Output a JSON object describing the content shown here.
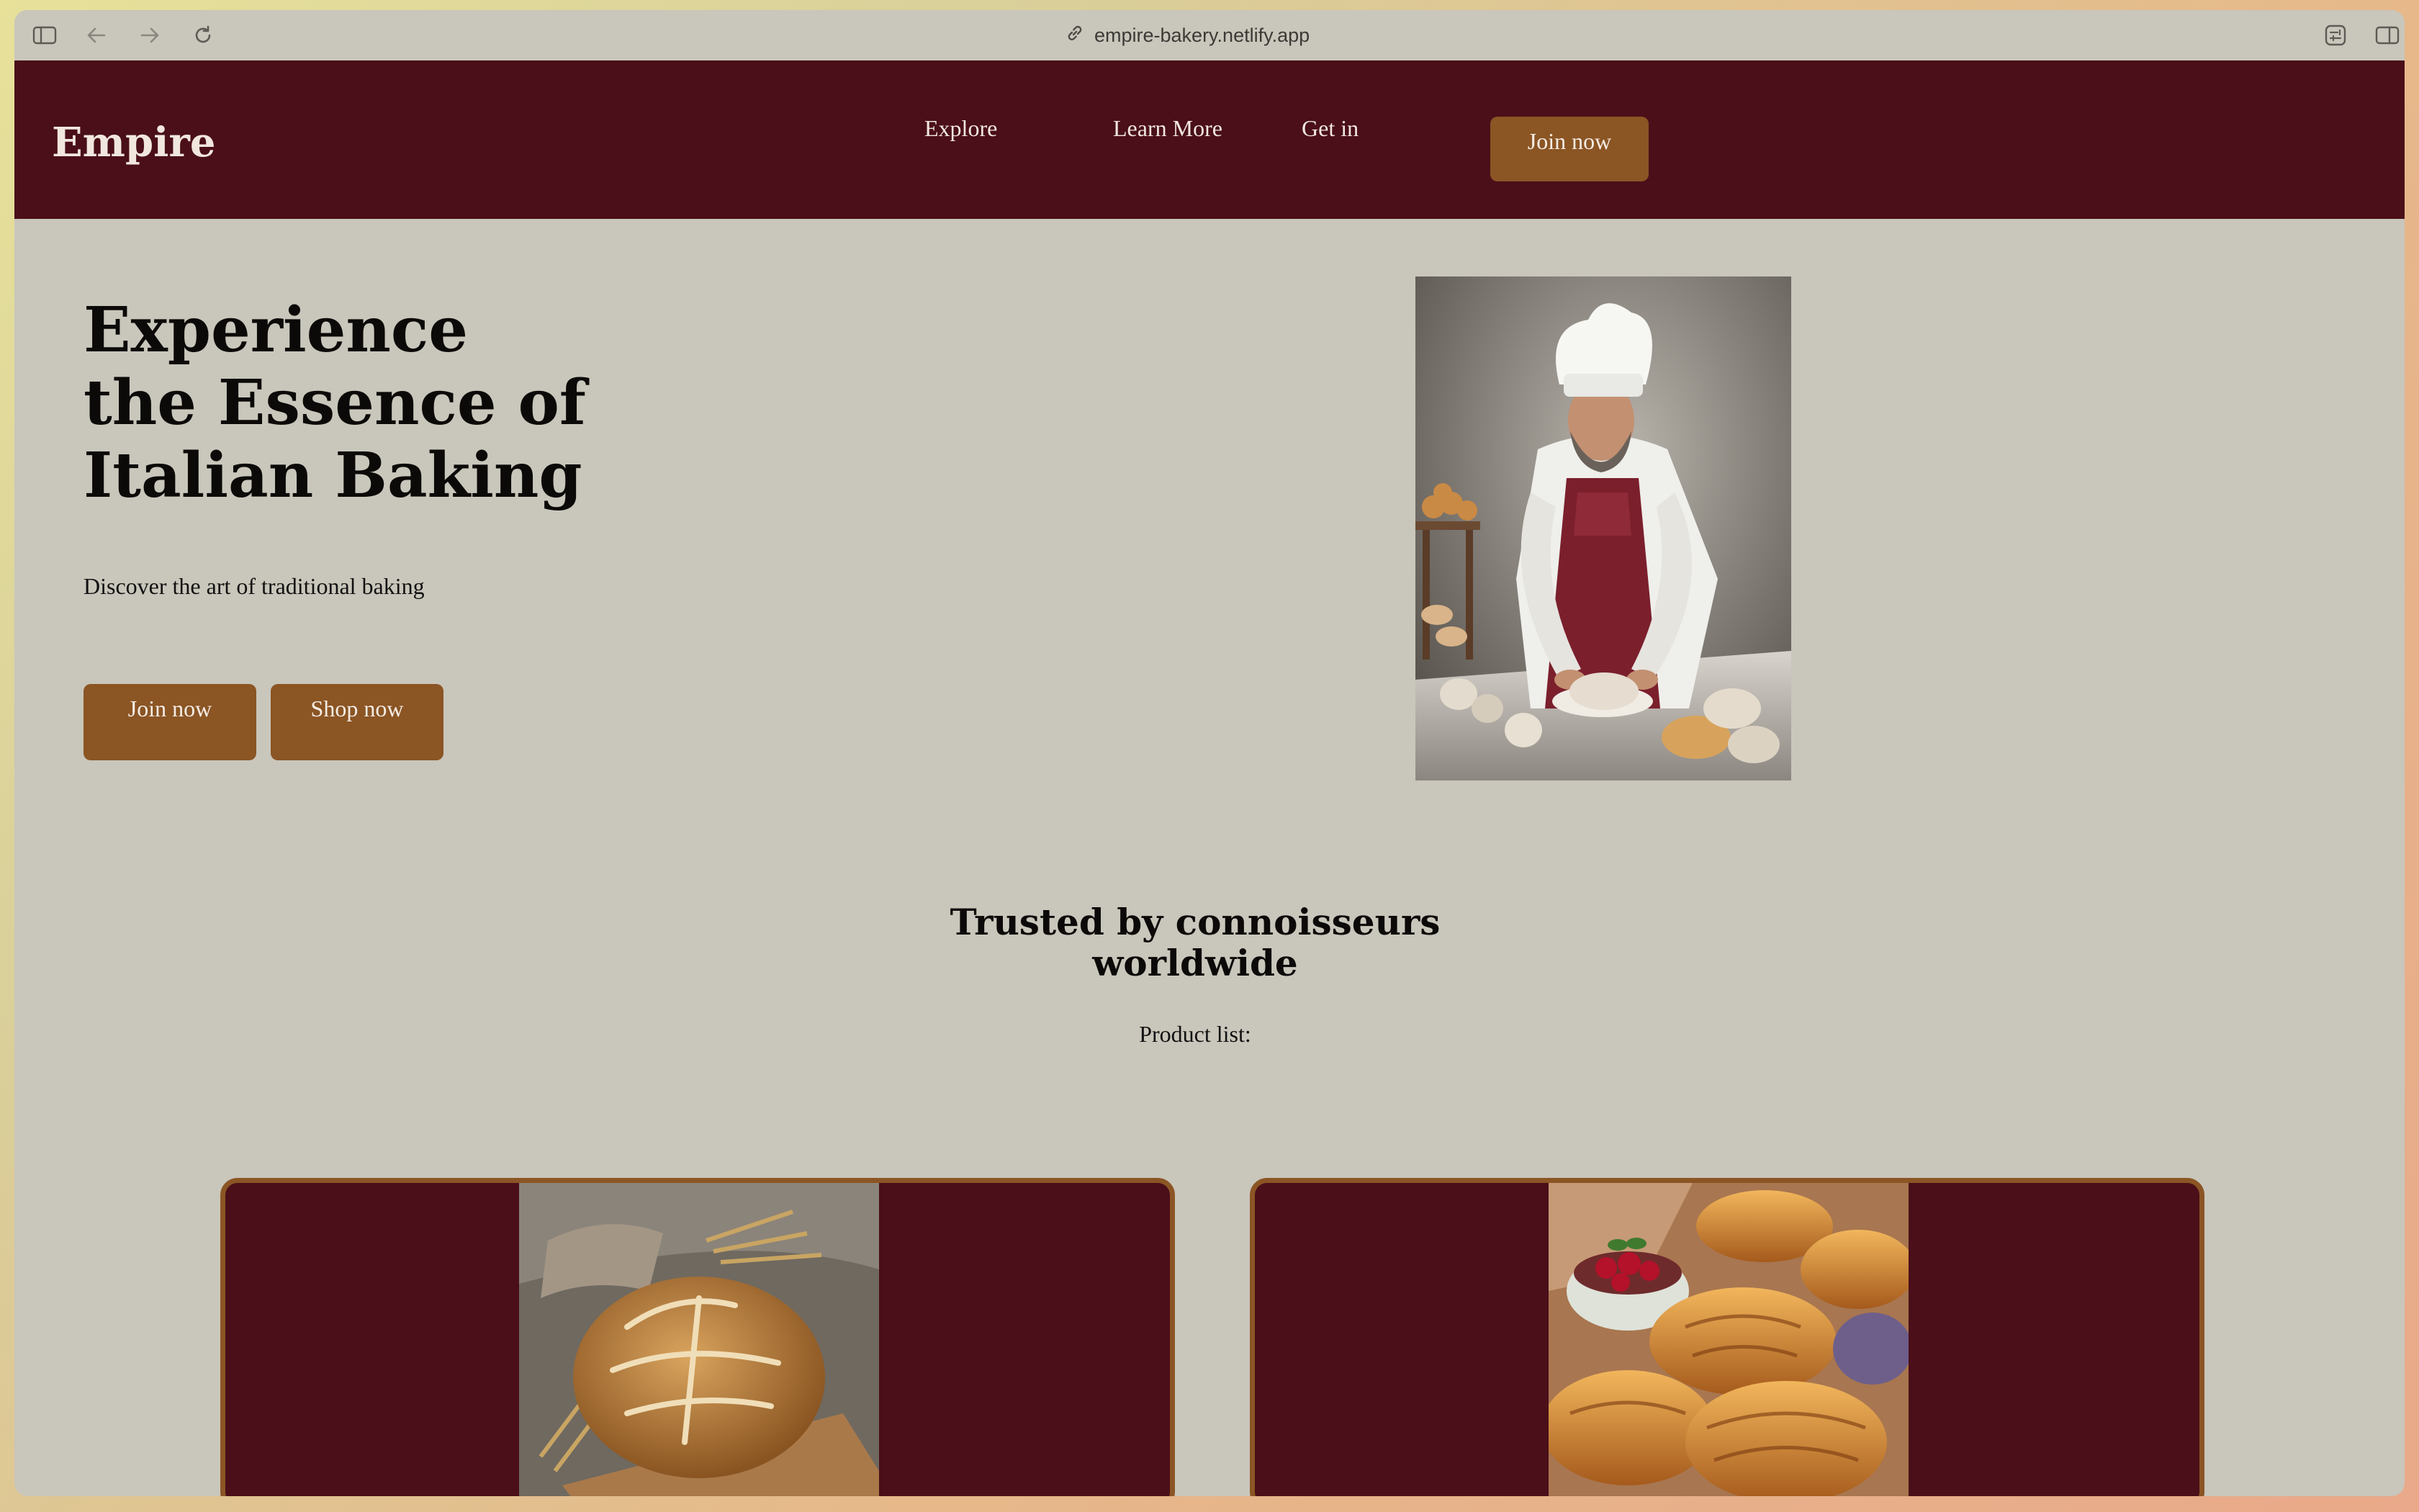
{
  "browser": {
    "url": "empire-bakery.netlify.app"
  },
  "header": {
    "logo": "Empire",
    "nav": [
      "Explore",
      "Learn More",
      "Get in"
    ],
    "cta": "Join now"
  },
  "hero": {
    "title_lines": [
      "Experience",
      "the Essence of",
      "Italian Baking"
    ],
    "subtitle": "Discover the art of traditional baking",
    "buttons": [
      "Join now",
      "Shop now"
    ]
  },
  "trusted": {
    "title_lines": [
      "Trusted by connoisseurs",
      "worldwide"
    ],
    "product_label": "Product list:"
  },
  "colors": {
    "header_bg": "#4a0f19",
    "button_bg": "#8b5524",
    "page_bg": "#c9c6bb"
  }
}
